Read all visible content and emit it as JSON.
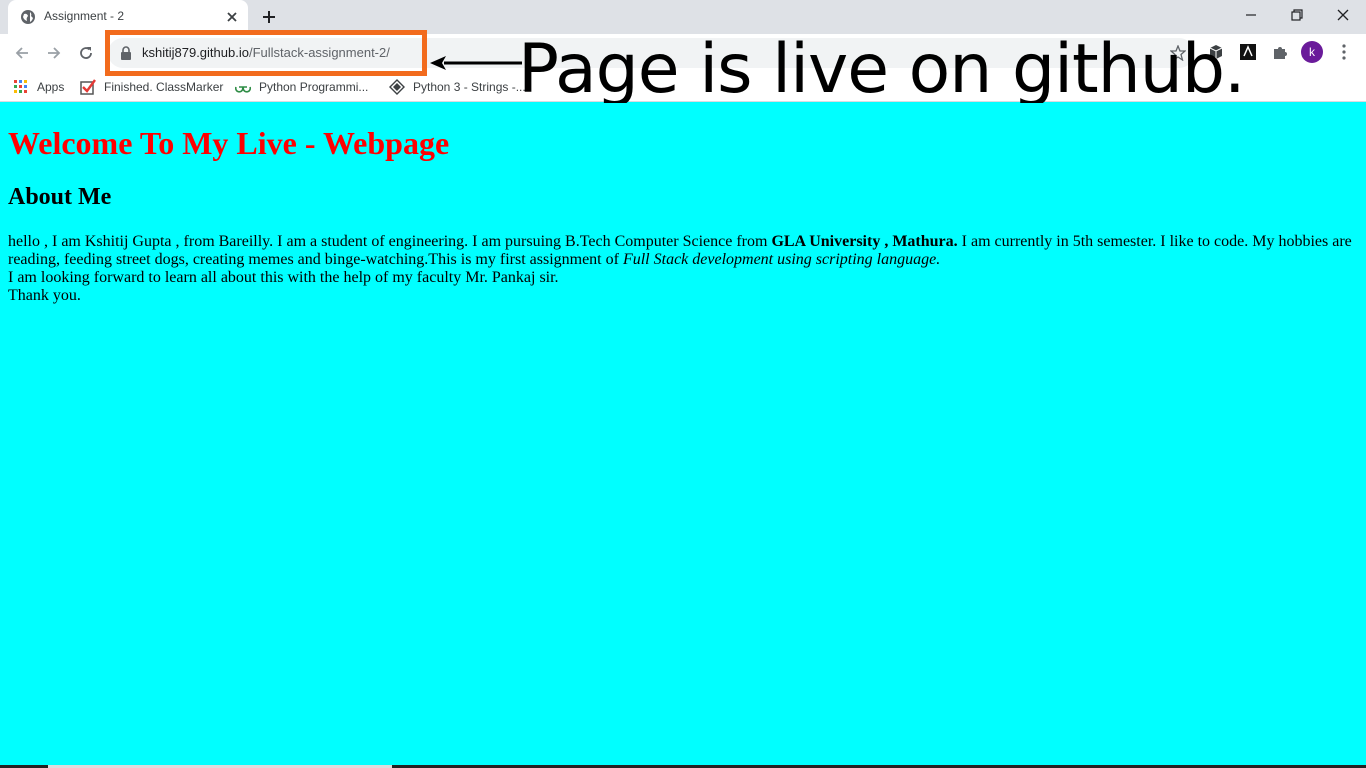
{
  "browser": {
    "tab": {
      "title": "Assignment - 2"
    },
    "url": {
      "host": "kshitij879.github.io",
      "path": "/Fullstack-assignment-2/"
    },
    "profile_initial": "k",
    "bookmarks": [
      {
        "label": "Apps",
        "icon": "apps-grid-icon"
      },
      {
        "label": "Finished. ClassMarker",
        "icon": "classmarker-check-icon"
      },
      {
        "label": "Python Programmi...",
        "icon": "geeksforgeeks-icon"
      },
      {
        "label": "Python 3 - Strings -...",
        "icon": "python-diamond-icon"
      }
    ]
  },
  "annotation": {
    "text": "Page is live on github.",
    "highlight_color": "#f26b1d"
  },
  "page": {
    "heading": "Welcome To My Live - Webpage",
    "heading_color": "#ff0000",
    "subheading": "About Me",
    "background": "#00ffff",
    "para_part1": "hello , I am Kshitij Gupta , from Bareilly. I am a student of engineering. I am pursuing B.Tech Computer Science from ",
    "para_bold": "GLA University , Mathura.",
    "para_part2": " I am currently in 5th semester. I like to code. My hobbies are reading, feeding street dogs, creating memes and binge-watching.This is my first assignment of ",
    "para_italic": "Full Stack development using scripting language.",
    "line2": "I am looking forward to learn all about this with the help of my faculty Mr. Pankaj sir.",
    "line3": "Thank you."
  }
}
